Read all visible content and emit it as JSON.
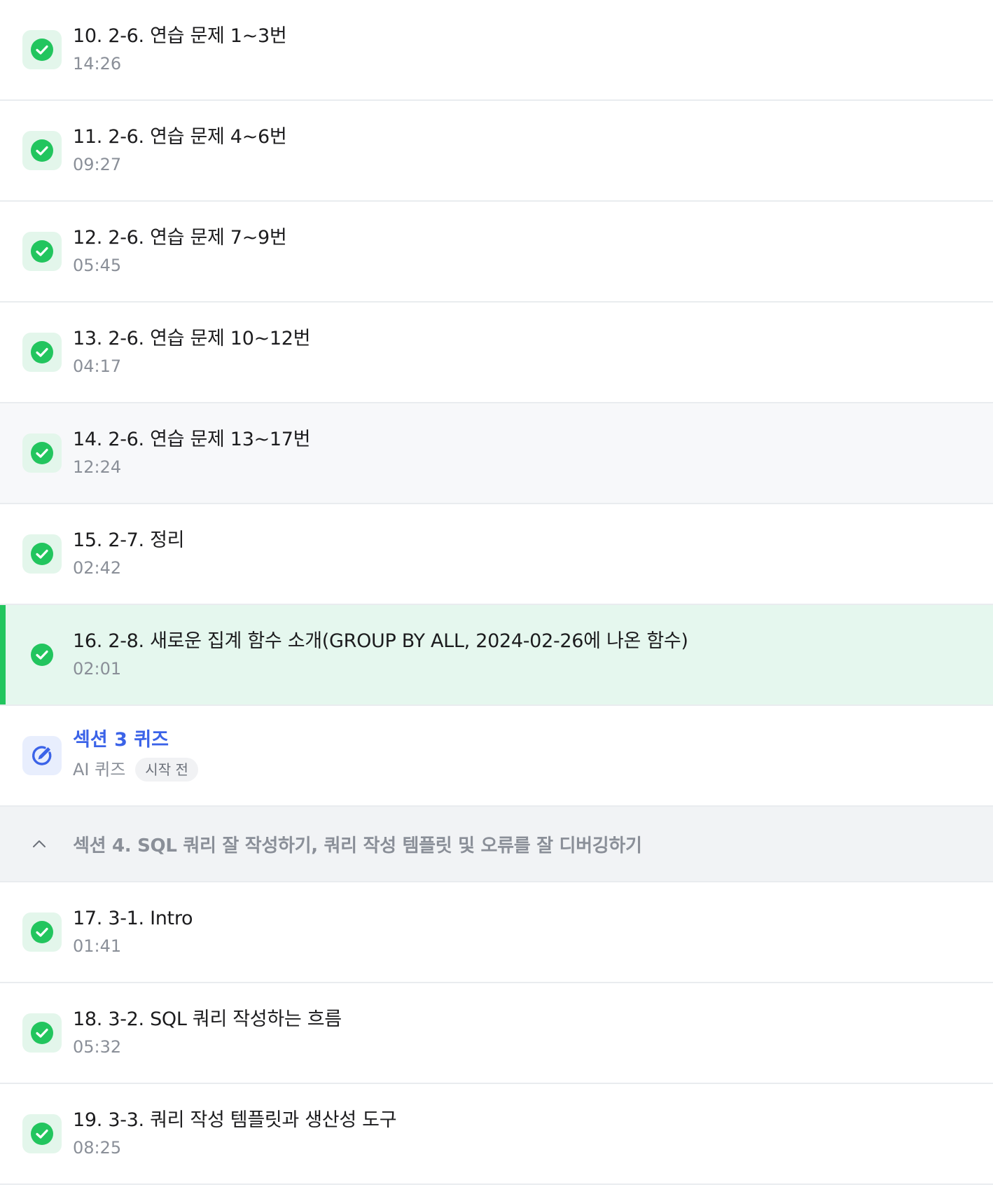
{
  "colors": {
    "accent_green": "#22c55e",
    "active_bg": "#e5f7ee",
    "hover_bg": "#f7f8fa",
    "quiz_blue": "#3b63e8",
    "section_bg": "#f1f3f5"
  },
  "lessons_top": [
    {
      "title": "10. 2-6. 연습 문제 1~3번",
      "duration": "14:26",
      "state": "done",
      "icon": "check-circle-icon"
    },
    {
      "title": "11. 2-6. 연습 문제 4~6번",
      "duration": "09:27",
      "state": "done",
      "icon": "check-circle-icon"
    },
    {
      "title": "12. 2-6. 연습 문제 7~9번",
      "duration": "05:45",
      "state": "done",
      "icon": "check-circle-icon"
    },
    {
      "title": "13. 2-6. 연습 문제 10~12번",
      "duration": "04:17",
      "state": "done",
      "icon": "check-circle-icon"
    },
    {
      "title": "14. 2-6. 연습 문제 13~17번",
      "duration": "12:24",
      "state": "done-hover",
      "icon": "check-circle-icon"
    },
    {
      "title": "15. 2-7. 정리",
      "duration": "02:42",
      "state": "done",
      "icon": "check-circle-icon"
    },
    {
      "title": "16. 2-8. 새로운 집계 함수 소개(GROUP BY ALL, 2024-02-26에 나온 함수)",
      "duration": "02:01",
      "state": "done-active",
      "icon": "check-circle-icon"
    }
  ],
  "quiz": {
    "title": "섹션 3 퀴즈",
    "type_label": "AI 퀴즈",
    "status_badge": "시작 전",
    "icon": "quiz-edit-icon"
  },
  "section": {
    "title": "섹션 4. SQL 쿼리 잘 작성하기, 쿼리 작성 템플릿 및 오류를 잘 디버깅하기",
    "icon": "chevron-up-icon"
  },
  "lessons_bottom": [
    {
      "title": "17. 3-1. Intro",
      "duration": "01:41",
      "state": "done",
      "icon": "check-circle-icon"
    },
    {
      "title": "18. 3-2. SQL 쿼리 작성하는 흐름",
      "duration": "05:32",
      "state": "done",
      "icon": "check-circle-icon"
    },
    {
      "title": "19. 3-3. 쿼리 작성 템플릿과 생산성 도구",
      "duration": "08:25",
      "state": "done",
      "icon": "check-circle-icon"
    }
  ]
}
